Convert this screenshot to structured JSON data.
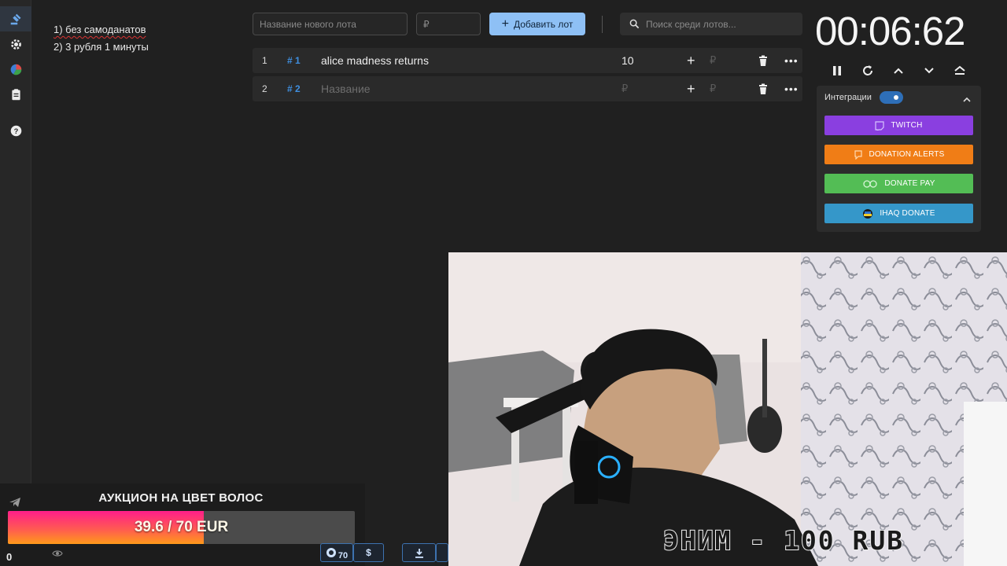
{
  "rules": [
    "1) без самоданатов",
    "2) 3 рубля 1 минуты"
  ],
  "controls": {
    "lot_name_placeholder": "Название нового лота",
    "amount_placeholder": "₽",
    "add_label": "Добавить лот",
    "search_placeholder": "Поиск среди лотов..."
  },
  "lots": [
    {
      "index": "1",
      "id": "# 1",
      "name": "alice madness returns",
      "amount": "10",
      "currency": "₽"
    },
    {
      "index": "2",
      "id": "# 2",
      "name": "Название",
      "amount": "₽",
      "currency": "₽"
    }
  ],
  "timer": "00:06:62",
  "integrations": {
    "title": "Интеграции",
    "enabled": true,
    "services": [
      {
        "label": "TWITCH",
        "color": "#8a3fe0"
      },
      {
        "label": "DONATION ALERTS",
        "color": "#f07d16"
      },
      {
        "label": "DONATE PAY",
        "color": "#53bd55"
      },
      {
        "label": "IHAQ DONATE",
        "color": "#3597c9"
      }
    ]
  },
  "goal": {
    "title": "АУКЦИОН НА ЦВЕТ ВОЛОС",
    "text": "39.6 / 70 EUR",
    "current": 39.6,
    "target": 70,
    "counter": "0"
  },
  "toolbar": {
    "badge": "70",
    "dollar": "$"
  },
  "stream_overlay_text": "ЭНИМ - 100 RUB",
  "colors": {
    "accent": "#8ec0f5",
    "id": "#3f8fe0",
    "background": "#202020"
  }
}
